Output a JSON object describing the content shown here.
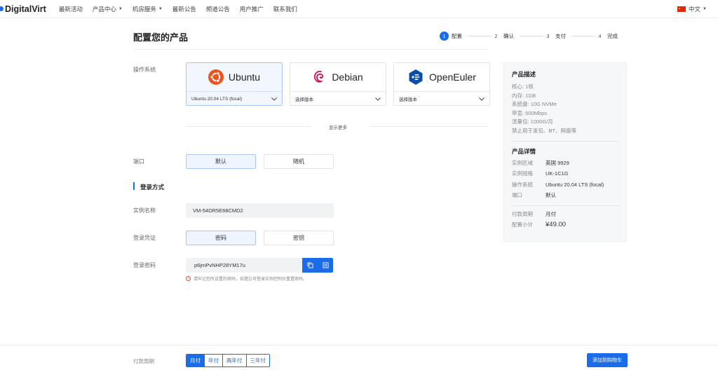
{
  "nav": {
    "brand": "DigitalVirt",
    "items": [
      {
        "label": "最新活动",
        "dropdown": false
      },
      {
        "label": "产品中心",
        "dropdown": true
      },
      {
        "label": "机房服务",
        "dropdown": true
      },
      {
        "label": "最新公告",
        "dropdown": false
      },
      {
        "label": "频道公告",
        "dropdown": false
      },
      {
        "label": "用户推广",
        "dropdown": false
      },
      {
        "label": "联系我们",
        "dropdown": false
      }
    ],
    "caret": "▼",
    "language": "中文"
  },
  "page": {
    "title": "配置您的产品"
  },
  "steps": [
    {
      "num": "1",
      "label": "配置",
      "active": true
    },
    {
      "num": "2",
      "label": "确认",
      "active": false
    },
    {
      "num": "3",
      "label": "支付",
      "active": false
    },
    {
      "num": "4",
      "label": "完成",
      "active": false
    }
  ],
  "os": {
    "label": "操作系统",
    "cards": [
      {
        "name": "Ubuntu",
        "version": "Ubuntu 20.04 LTS (focal)",
        "selected": true
      },
      {
        "name": "Debian",
        "version": "选择版本",
        "selected": false
      },
      {
        "name": "OpenEuler",
        "version": "选择版本",
        "selected": false
      }
    ],
    "show_more": "显示更多"
  },
  "port": {
    "label": "端口",
    "options": [
      "默认",
      "随机"
    ],
    "selected": 0
  },
  "login": {
    "section_title": "登录方式",
    "instance_name_label": "实例名称",
    "instance_name_value": "VM-54DR5E68CMD2",
    "credential_label": "登录凭证",
    "credential_options": [
      "密码",
      "密钥"
    ],
    "credential_selected": 0,
    "password_label": "登录密码",
    "password_value": "p6jmPvNHP28YM17u",
    "hint": "请牢记您所设置的密码，如遗忘可登录实例控制台重置密码。"
  },
  "summary": {
    "desc_title": "产品描述",
    "desc_lines": [
      "核心: 1核",
      "内存: 1GB",
      "系统盘: 10G NVMe",
      "带宽: 500Mbps",
      "流量包: 1000G/月",
      "禁止用于发包、BT、网盘等"
    ],
    "detail_title": "产品详情",
    "details": [
      {
        "k": "实例区域",
        "v": "英国 9929"
      },
      {
        "k": "实例规格",
        "v": "UK-1C1G"
      },
      {
        "k": "操作系统",
        "v": "Ubuntu 20.04 LTS (focal)"
      },
      {
        "k": "端口",
        "v": "默认"
      }
    ],
    "billing": [
      {
        "k": "付款周期",
        "v": "月付"
      },
      {
        "k": "配置小计",
        "v": "¥49.00"
      }
    ]
  },
  "footer": {
    "cycle_label": "付款周期",
    "cycles": [
      "月付",
      "年付",
      "两年付",
      "三年付"
    ],
    "cycle_selected": 0,
    "cart_button": "添加到购物车"
  },
  "colors": {
    "accent": "#1a6ce8",
    "price": "#f07a1a",
    "ubuntu": "#e95420",
    "debian": "#d70a53",
    "openeuler": "#0a4ea8"
  }
}
